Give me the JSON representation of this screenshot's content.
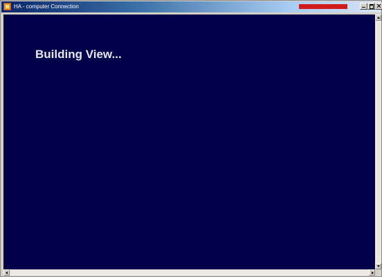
{
  "window": {
    "title": "HA - computer Connection",
    "progress_fraction": 0.95,
    "colors": {
      "titlebar_start": "#0a246a",
      "titlebar_end": "#d8e4f4",
      "progress": "#d21c1c",
      "content_background": "#02024a",
      "status_text": "#e6e6f0"
    }
  },
  "content": {
    "status_text": "Building View..."
  },
  "icons": {
    "app": "app-icon",
    "minimize": "minimize-icon",
    "maximize": "maximize-icon",
    "close": "close-icon"
  }
}
